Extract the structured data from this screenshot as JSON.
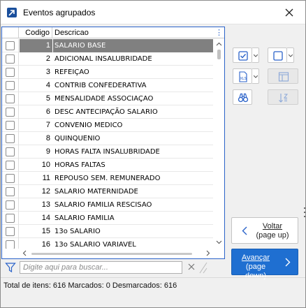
{
  "window": {
    "title": "Eventos agrupados"
  },
  "grid": {
    "columns": {
      "codigo": "Codigo",
      "descricao": "Descricao"
    },
    "rows": [
      {
        "codigo": "1",
        "descricao": "SALARIO BASE"
      },
      {
        "codigo": "2",
        "descricao": "ADICIONAL INSALUBRIDADE"
      },
      {
        "codigo": "3",
        "descricao": "REFEIÇAO"
      },
      {
        "codigo": "4",
        "descricao": "CONTRIB CONFEDERATIVA"
      },
      {
        "codigo": "5",
        "descricao": "MENSALIDADE ASSOCIAÇAO"
      },
      {
        "codigo": "6",
        "descricao": "DESC ANTECIPAÇÃO SALARIO"
      },
      {
        "codigo": "7",
        "descricao": "CONVENIO MEDICO"
      },
      {
        "codigo": "8",
        "descricao": "QUINQUENIO"
      },
      {
        "codigo": "9",
        "descricao": "HORAS FALTA INSALUBRIDADE"
      },
      {
        "codigo": "10",
        "descricao": "HORAS FALTAS"
      },
      {
        "codigo": "11",
        "descricao": "REPOUSO SEM. REMUNERADO"
      },
      {
        "codigo": "12",
        "descricao": "SALARIO MATERNIDADE"
      },
      {
        "codigo": "13",
        "descricao": "SALARIO FAMILIA RESCISAO"
      },
      {
        "codigo": "14",
        "descricao": "SALARIO FAMILIA"
      },
      {
        "codigo": "15",
        "descricao": "13o SALARIO"
      },
      {
        "codigo": "16",
        "descricao": "13o SALARIO VARIAVEL"
      }
    ],
    "selected_codigo": "1"
  },
  "search": {
    "placeholder": "Digite aqui para buscar...",
    "value": ""
  },
  "toolbar": {
    "icons": [
      "check-all-icon",
      "uncheck-all-icon",
      "export-xls-icon",
      "layout-icon",
      "binoculars-icon",
      "sort-icon"
    ],
    "xls_label": "XLS"
  },
  "nav": {
    "back_main": "Voltar",
    "back_sub": "(page up)",
    "next_main": "Avançar",
    "next_sub": "(page down)"
  },
  "status": {
    "text": "Total de itens: 616 Marcados: 0 Desmarcados: 616"
  },
  "colors": {
    "accent": "#1f6fd1",
    "selected_row": "#808080",
    "grid_border": "#2a62c9"
  }
}
